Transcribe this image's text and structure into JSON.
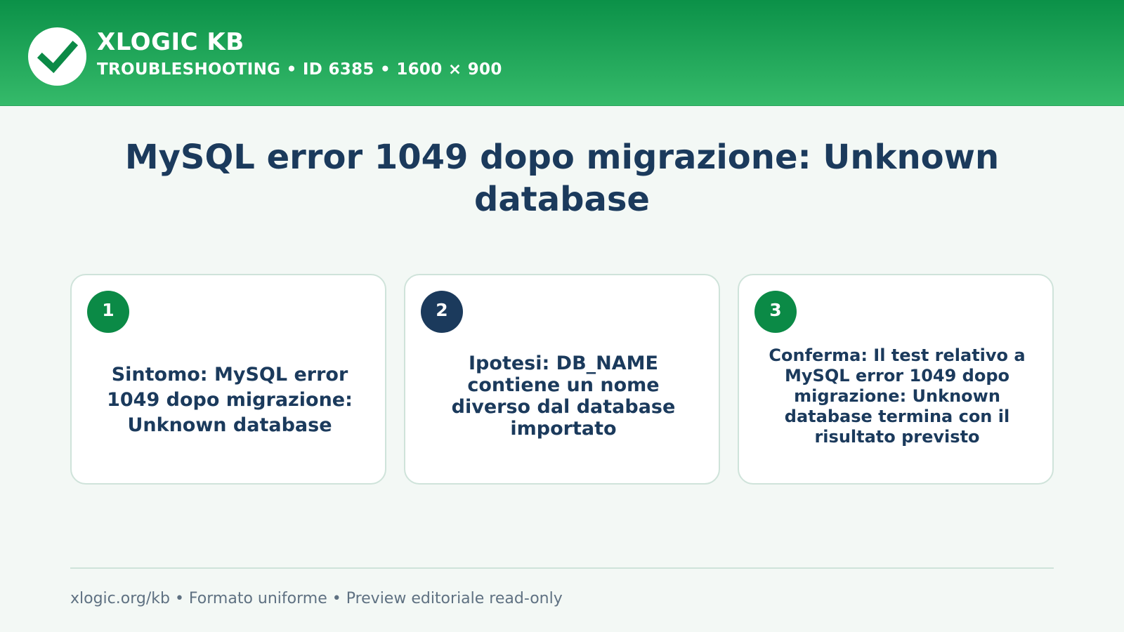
{
  "header": {
    "brand": "XLOGIC KB",
    "subtitle": "TROUBLESHOOTING • ID 6385 • 1600 × 900",
    "logo_icon": "checkmark-icon"
  },
  "title": "MySQL error 1049 dopo migrazione: Unknown database",
  "cards": [
    {
      "number": "1",
      "text": "Sintomo: MySQL error 1049 dopo migrazione: Unknown database",
      "badge_color": "#0b8a46"
    },
    {
      "number": "2",
      "text": "Ipotesi: DB_NAME contiene un nome diverso dal database importato",
      "badge_color": "#1b3a5c"
    },
    {
      "number": "3",
      "text": "Conferma: Il test relativo a MySQL error 1049 dopo migrazione: Unknown database termina con il risultato previsto",
      "badge_color": "#0b8a46"
    }
  ],
  "footer": "xlogic.org/kb • Formato uniforme • Preview editoriale read-only",
  "colors": {
    "header_top": "#0b9148",
    "header_bottom": "#35ba6a",
    "title": "#1b3a5c",
    "background": "#f3f8f5"
  }
}
